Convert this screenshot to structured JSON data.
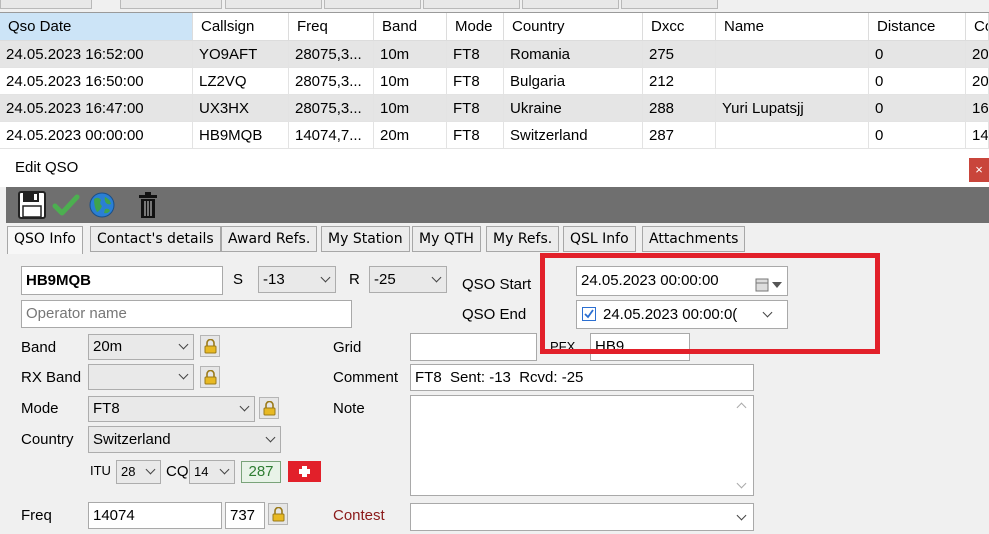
{
  "grid": {
    "headers": [
      "Qso Date",
      "Callsign",
      "Freq",
      "Band",
      "Mode",
      "Country",
      "Dxcc",
      "Name",
      "Distance",
      "Co"
    ],
    "rows": [
      [
        "24.05.2023 16:52:00",
        "YO9AFT",
        "28075,3...",
        "10m",
        "FT8",
        "Romania",
        "275",
        "",
        "0",
        "20"
      ],
      [
        "24.05.2023 16:50:00",
        "LZ2VQ",
        "28075,3...",
        "10m",
        "FT8",
        "Bulgaria",
        "212",
        "",
        "0",
        "20"
      ],
      [
        "24.05.2023 16:47:00",
        "UX3HX",
        "28075,3...",
        "10m",
        "FT8",
        "Ukraine",
        "288",
        "Yuri Lupatsjj",
        "0",
        "16"
      ],
      [
        "24.05.2023 00:00:00",
        "HB9MQB",
        "14074,7...",
        "20m",
        "FT8",
        "Switzerland",
        "287",
        "",
        "0",
        "14"
      ]
    ]
  },
  "window": {
    "title": "Edit QSO",
    "close": "×"
  },
  "toolbar": {
    "icons": [
      "save-icon",
      "confirm-check-icon",
      "globe-icon",
      "delete-trash-icon"
    ]
  },
  "tabs": [
    "QSO Info",
    "Contact's details",
    "Award Refs.",
    "My Station",
    "My QTH",
    "My Refs.",
    "QSL Info",
    "Attachments"
  ],
  "form": {
    "callsign": "HB9MQB",
    "s_label": "S",
    "s_value": "-13",
    "r_label": "R",
    "r_value": "-25",
    "operator_placeholder": "Operator name",
    "qso_start_label": "QSO Start",
    "qso_start_value": "24.05.2023 00:00:00",
    "qso_end_label": "QSO End",
    "qso_end_value": "24.05.2023 00:00:0(",
    "band_label": "Band",
    "band_value": "20m",
    "rx_band_label": "RX Band",
    "rx_band_value": "",
    "mode_label": "Mode",
    "mode_value": "FT8",
    "country_label": "Country",
    "country_value": "Switzerland",
    "itu_label": "ITU",
    "itu_value": "28",
    "cq_label": "CQ",
    "cq_value": "14",
    "dxcc_value": "287",
    "grid_label": "Grid",
    "grid_value": "",
    "pfx_label": "PFX",
    "pfx_value": "HB9",
    "comment_label": "Comment",
    "comment_value": "FT8  Sent: -13  Rcvd: -25",
    "note_label": "Note",
    "note_value": "",
    "freq_label": "Freq",
    "freq_value": "14074",
    "freq_offset": "737",
    "contest_label": "Contest",
    "contest_value": ""
  },
  "colors": {
    "highlight": "#e2202a",
    "contest_label": "#8b1a1a",
    "dxcc_badge": "#2e7d32",
    "flag": "#e2202a"
  }
}
